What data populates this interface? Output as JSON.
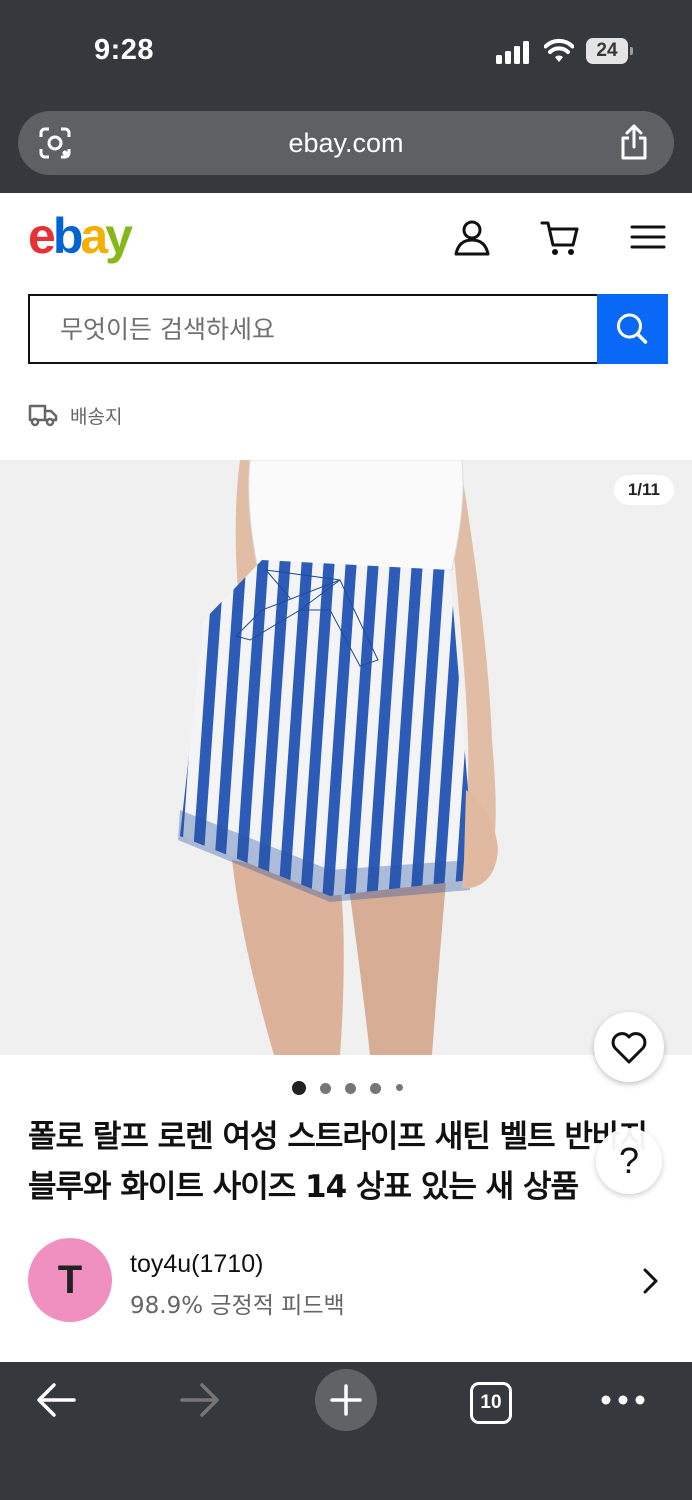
{
  "status": {
    "time": "9:28",
    "battery": "24"
  },
  "browser": {
    "url": "ebay.com"
  },
  "header": {
    "logo": {
      "e": "e",
      "b": "b",
      "a": "a",
      "y": "y"
    }
  },
  "search": {
    "placeholder": "무엇이든 검색하세요"
  },
  "shipping": {
    "label": "배송지"
  },
  "gallery": {
    "counter": "1/11",
    "dot_count": 5,
    "active_dot": 0
  },
  "product": {
    "title": "폴로 랄프 로렌 여성 스트라이프 새틴 벨트 반바지 블루와 화이트 사이즈 14 상표 있는 새 상품"
  },
  "help": {
    "label": "?"
  },
  "seller": {
    "avatar_letter": "T",
    "name": "toy4u(1710)",
    "feedback": "98.9% 긍정적 피드백"
  },
  "toolbar": {
    "tab_count": "10"
  },
  "colors": {
    "ebay_blue": "#0968f6",
    "chrome_dark": "#35383c",
    "avatar_pink": "#f090c0"
  }
}
